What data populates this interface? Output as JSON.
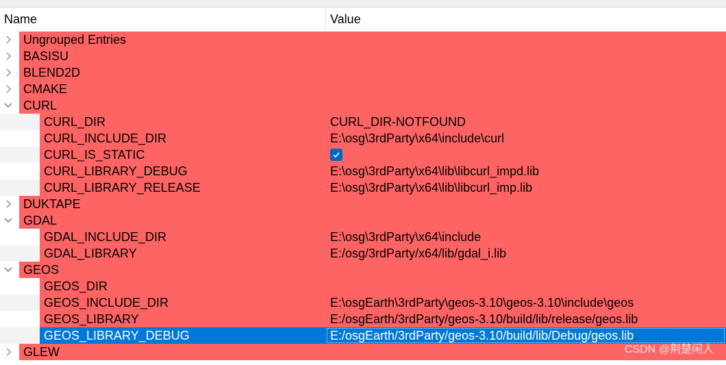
{
  "header": {
    "name_col": "Name",
    "value_col": "Value"
  },
  "rows": [
    {
      "kind": "group",
      "expanded": false,
      "name": "Ungrouped Entries",
      "value": ""
    },
    {
      "kind": "group",
      "expanded": false,
      "name": "BASISU",
      "value": ""
    },
    {
      "kind": "group",
      "expanded": false,
      "name": "BLEND2D",
      "value": ""
    },
    {
      "kind": "group",
      "expanded": false,
      "name": "CMAKE",
      "value": ""
    },
    {
      "kind": "group",
      "expanded": true,
      "name": "CURL",
      "value": ""
    },
    {
      "kind": "child",
      "name": "CURL_DIR",
      "value": "CURL_DIR-NOTFOUND"
    },
    {
      "kind": "child",
      "name": "CURL_INCLUDE_DIR",
      "value": "E:\\osg\\3rdParty\\x64\\include\\curl"
    },
    {
      "kind": "child",
      "name": "CURL_IS_STATIC",
      "value": "",
      "checkbox": true,
      "checked": true
    },
    {
      "kind": "child",
      "name": "CURL_LIBRARY_DEBUG",
      "value": "E:\\osg\\3rdParty\\x64\\lib\\libcurl_impd.lib"
    },
    {
      "kind": "child",
      "name": "CURL_LIBRARY_RELEASE",
      "value": "E:\\osg\\3rdParty\\x64\\lib\\libcurl_imp.lib"
    },
    {
      "kind": "group",
      "expanded": false,
      "name": "DUKTAPE",
      "value": ""
    },
    {
      "kind": "group",
      "expanded": true,
      "name": "GDAL",
      "value": ""
    },
    {
      "kind": "child",
      "name": "GDAL_INCLUDE_DIR",
      "value": "E:\\osg\\3rdParty\\x64\\include"
    },
    {
      "kind": "child",
      "name": "GDAL_LIBRARY",
      "value": "E:/osg/3rdParty/x64/lib/gdal_i.lib"
    },
    {
      "kind": "group",
      "expanded": true,
      "name": "GEOS",
      "value": ""
    },
    {
      "kind": "child",
      "name": "GEOS_DIR",
      "value": ""
    },
    {
      "kind": "child",
      "name": "GEOS_INCLUDE_DIR",
      "value": "E:\\osgEarth\\3rdParty\\geos-3.10\\geos-3.10\\include\\geos"
    },
    {
      "kind": "child",
      "name": "GEOS_LIBRARY",
      "value": "E:/osgEarth/3rdParty/geos-3.10/build/lib/release/geos.lib"
    },
    {
      "kind": "child",
      "name": "GEOS_LIBRARY_DEBUG",
      "value": "E:/osgEarth/3rdParty/geos-3.10/build/lib/Debug/geos.lib",
      "selected": true
    },
    {
      "kind": "group",
      "expanded": false,
      "name": "GLEW",
      "value": ""
    }
  ],
  "watermark": "CSDN @荆楚闲人",
  "colors": {
    "highlight": "#ff6464",
    "selection": "#0078d7"
  }
}
